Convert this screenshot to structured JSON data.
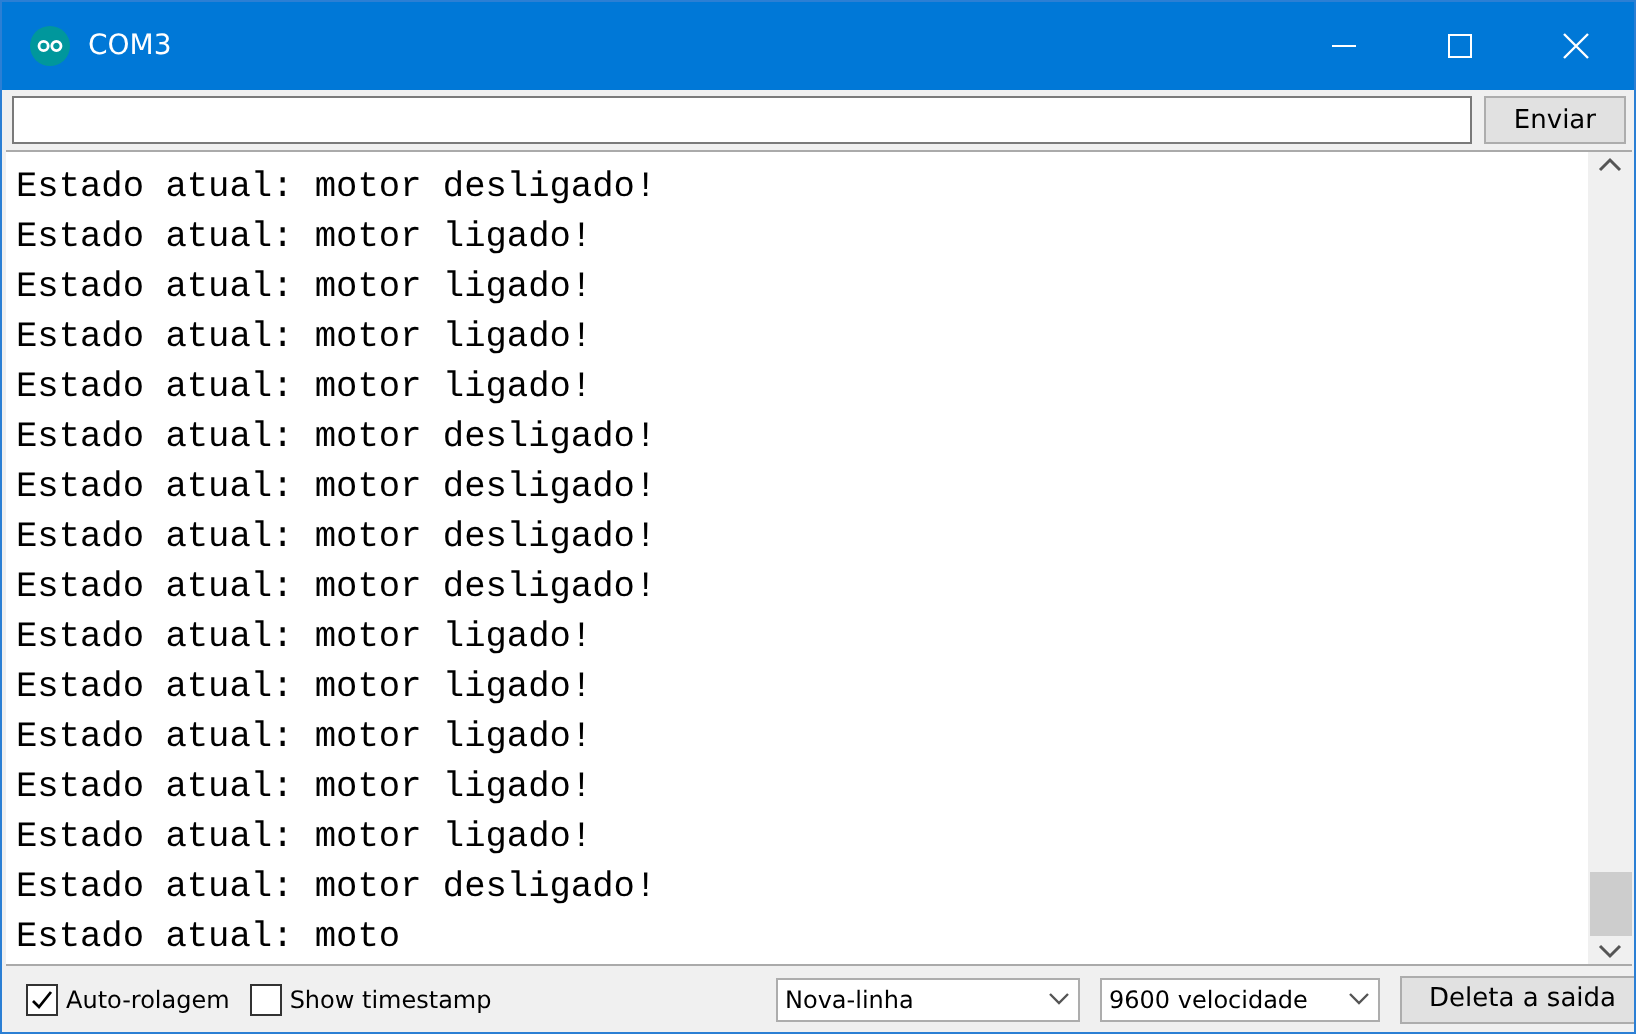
{
  "window": {
    "title": "COM3"
  },
  "send_button": "Enviar",
  "output": [
    "Estado atual: motor desligado!",
    "Estado atual: motor ligado!",
    "Estado atual: motor ligado!",
    "Estado atual: motor ligado!",
    "Estado atual: motor ligado!",
    "Estado atual: motor desligado!",
    "Estado atual: motor desligado!",
    "Estado atual: motor desligado!",
    "Estado atual: motor desligado!",
    "Estado atual: motor ligado!",
    "Estado atual: motor ligado!",
    "Estado atual: motor ligado!",
    "Estado atual: motor ligado!",
    "Estado atual: motor ligado!",
    "Estado atual: motor desligado!",
    "Estado atual: moto"
  ],
  "status_bar": {
    "checkboxes": [
      {
        "label": "Auto-rolagem",
        "checked": true
      },
      {
        "label": "Show timestamp",
        "checked": false
      }
    ],
    "selects": [
      "Nova-linha",
      "9600 velocidade"
    ],
    "clear_button": "Deleta a saida"
  }
}
